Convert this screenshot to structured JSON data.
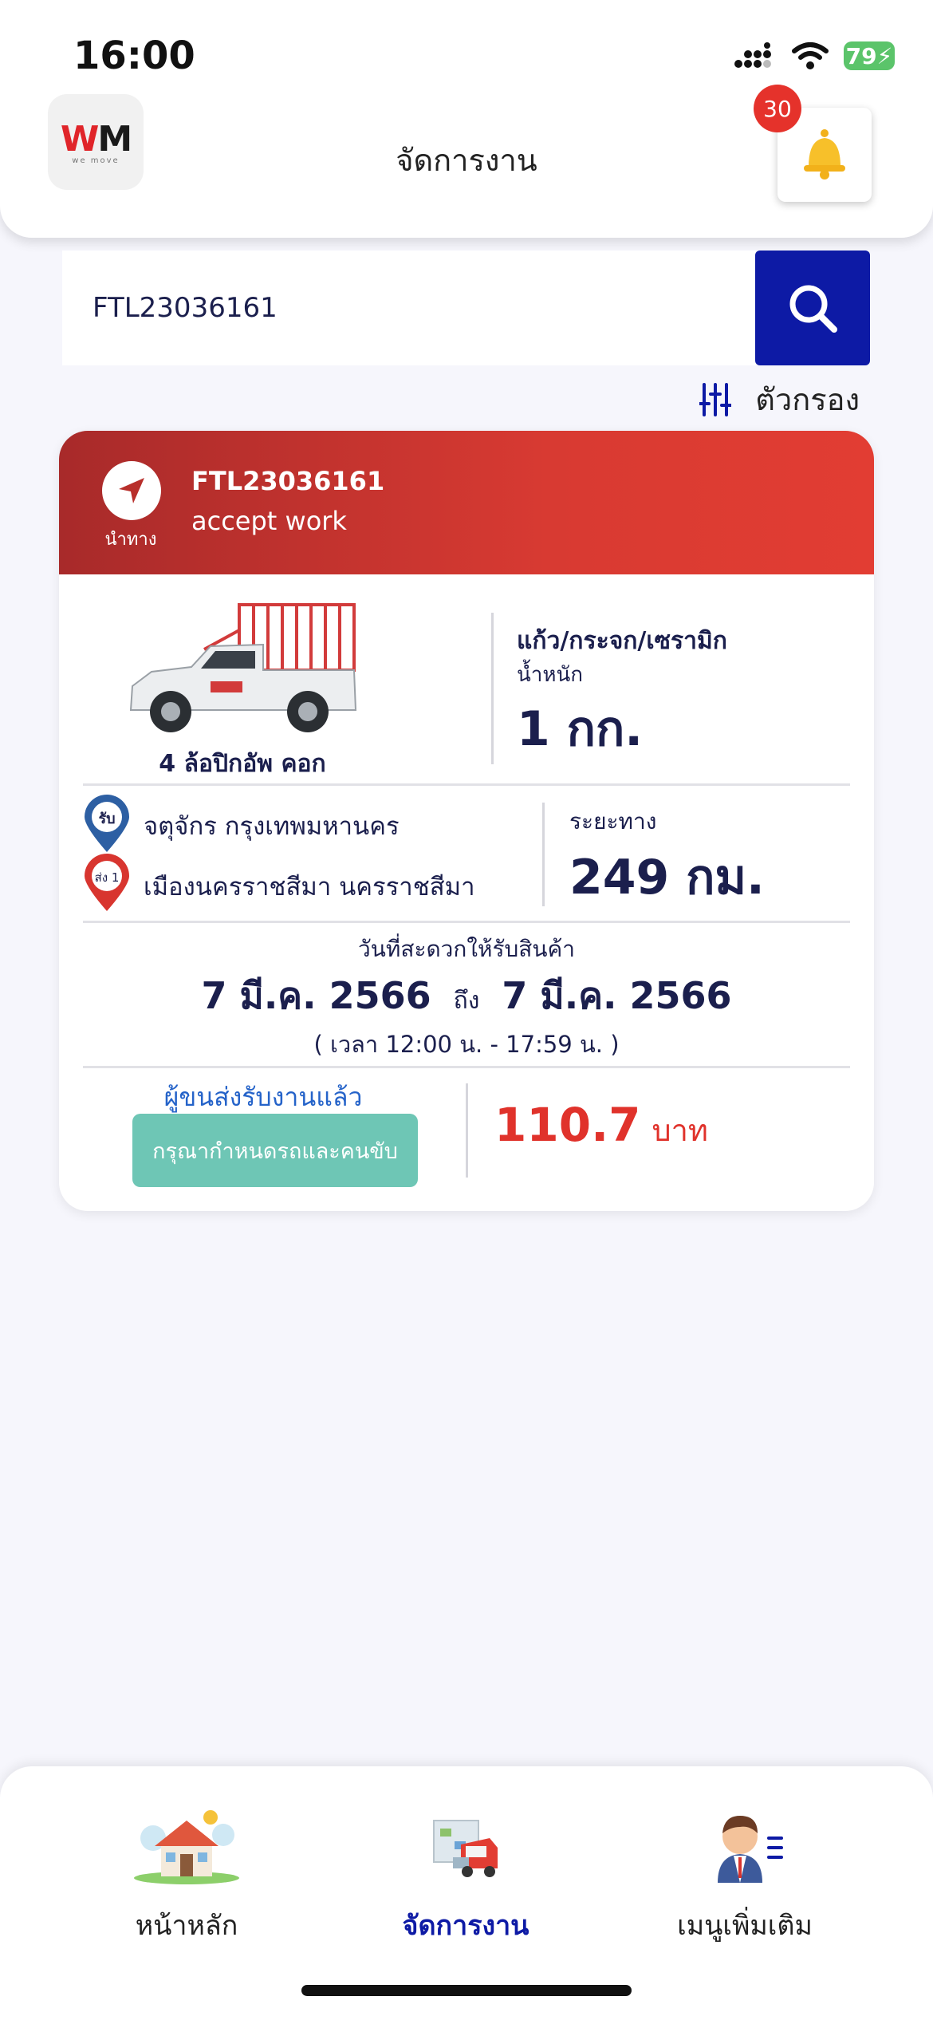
{
  "status_bar": {
    "time": "16:00",
    "battery": "79"
  },
  "header": {
    "logo_text_w": "W",
    "logo_text_m": "M",
    "logo_sub": "we move",
    "title": "จัดการงาน",
    "notification_count": "30"
  },
  "search": {
    "value": "FTL23036161",
    "filter_label": "ตัวกรอง"
  },
  "job": {
    "id": "FTL23036161",
    "status": "accept work",
    "nav_label": "นำทาง",
    "vehicle_type": "4 ล้อปิกอัพ คอก",
    "cargo_type": "แก้ว/กระจก/เซรามิก",
    "weight_label": "น้ำหนัก",
    "weight_value": "1 กก.",
    "pickup_pin": "รับ",
    "pickup": "จตุจักร กรุงเทพมหานคร",
    "drop_pin": "ส่ง 1",
    "drop": "เมืองนครราชสีมา นครราชสีมา",
    "distance_label": "ระยะทาง",
    "distance_value": "249 กม.",
    "date_label": "วันที่สะดวกให้รับสินค้า",
    "date_from": "7 มี.ค. 2566",
    "date_to_word": "ถึง",
    "date_to": "7 มี.ค. 2566",
    "time_range": "( เวลา 12:00 น. - 17:59 น. )",
    "accepted_text": "ผู้ขนส่งรับงานแล้ว",
    "assign_button": "กรุณากำหนดรถและคนขับ",
    "price": "110.7",
    "price_unit": "บาท"
  },
  "bottom_nav": {
    "items": [
      {
        "label": "หน้าหลัก",
        "icon": "home-icon"
      },
      {
        "label": "จัดการงาน",
        "icon": "manage-jobs-icon",
        "active": true
      },
      {
        "label": "เมนูเพิ่มเติม",
        "icon": "more-menu-icon"
      }
    ]
  },
  "colors": {
    "primary": "#0d1aa5",
    "card_header": "#d83a32",
    "price": "#e0322b",
    "assign_button": "#6ec6b5",
    "accepted_text": "#2563c9"
  }
}
